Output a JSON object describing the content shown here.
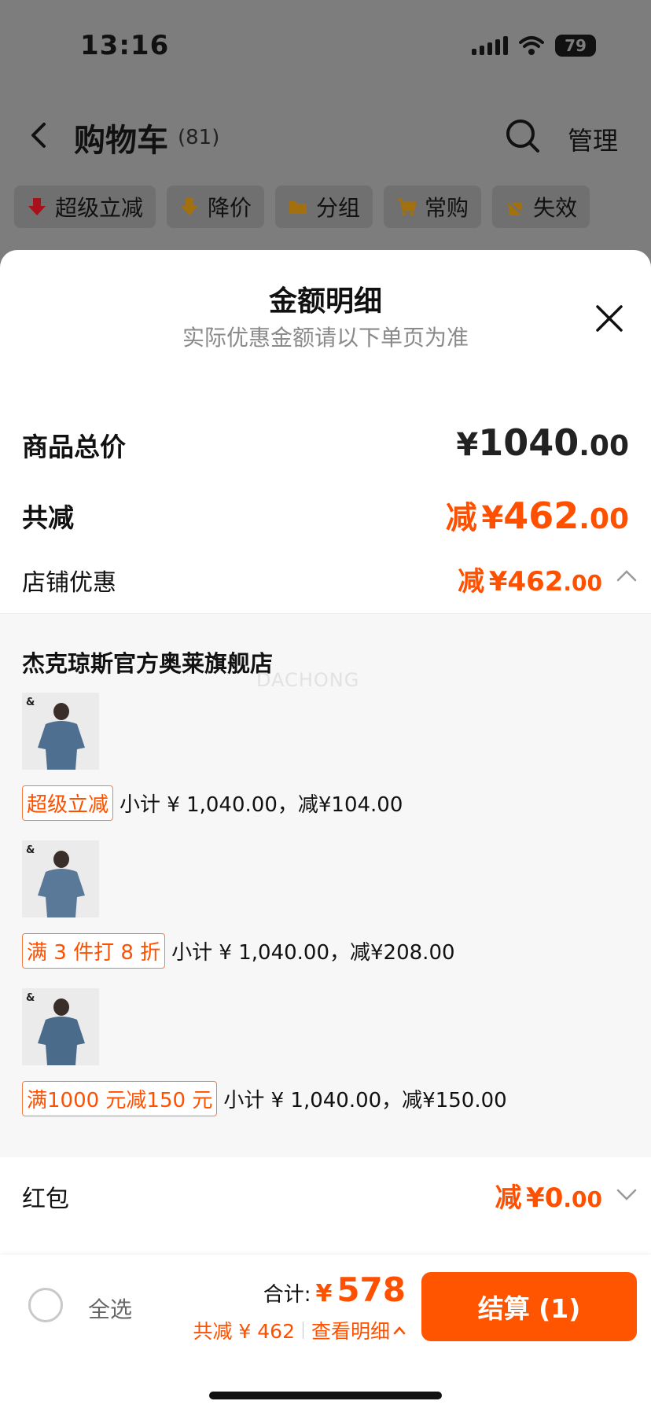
{
  "status_bar": {
    "time": "13:16",
    "battery": "79"
  },
  "cart_header": {
    "title": "购物车",
    "count": "(81)",
    "manage": "管理"
  },
  "filter_chips": [
    "超级立减",
    "降价",
    "分组",
    "常购",
    "失效"
  ],
  "sheet": {
    "title": "金额明细",
    "subtitle": "实际优惠金额请以下单页为准",
    "rows": {
      "goods_total": {
        "label": "商品总价",
        "sym": "¥",
        "int": "1040",
        "dec": ".00"
      },
      "total_reduce": {
        "label": "共减",
        "prefix": "减",
        "sym": "¥",
        "int": "462",
        "dec": ".00"
      },
      "store_discount": {
        "label": "店铺优惠",
        "prefix": "减",
        "sym": "¥",
        "int": "462",
        "dec": ".00"
      },
      "red_packet": {
        "label": "红包",
        "prefix": "减",
        "sym": "¥",
        "int": "0",
        "dec": ".00"
      }
    },
    "store": {
      "name": "杰克琼斯官方奥莱旗舰店",
      "watermark": "DACHONG",
      "items": [
        {
          "tag": "超级立减",
          "text": "小计 ¥ 1,040.00，减¥104.00"
        },
        {
          "tag": "满 3 件打 8 折",
          "text": "小计 ¥ 1,040.00，减¥208.00"
        },
        {
          "tag": "满1000 元减150 元",
          "text": "小计 ¥ 1,040.00，减¥150.00"
        }
      ]
    }
  },
  "bottom_bar": {
    "select_all": "全选",
    "total_label": "合计:",
    "total_sym": "¥",
    "total_amount": "578",
    "saved": "共减 ¥ 462",
    "view_detail": "查看明细",
    "checkout": "结算 (1)"
  },
  "colors": {
    "accent": "#ff5000",
    "checkout": "#ff5500",
    "overlay": "#7d7d7d"
  }
}
